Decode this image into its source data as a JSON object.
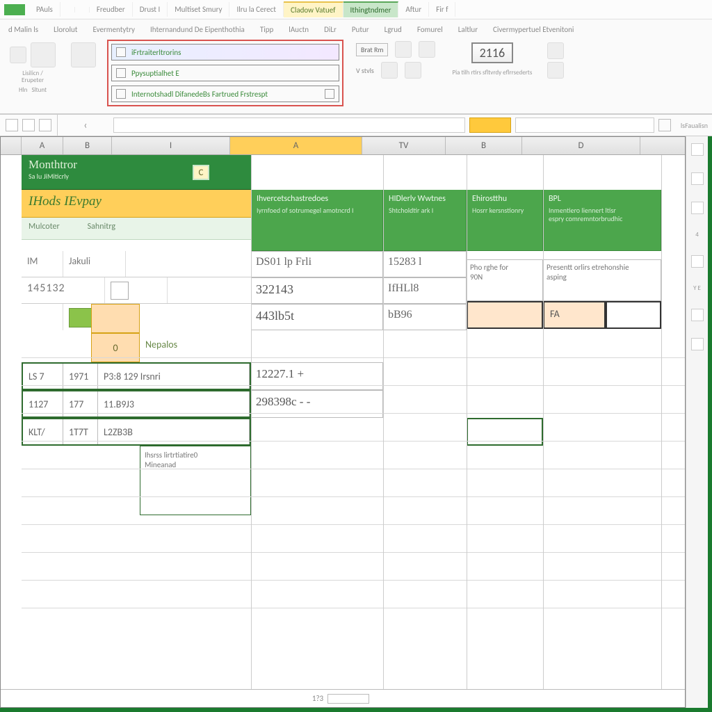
{
  "tabs": {
    "items": [
      "PAuls",
      "",
      "",
      "Freudber",
      "Drust I",
      "Multiset Smury",
      "Ilru la Cerect",
      "Cladow Vatuef",
      "Ithingtndmer",
      "Aftur",
      "Fir f"
    ],
    "active_yellow_index": 7,
    "active_green_index": 8
  },
  "ribbon_row1": [
    "d Malin ls",
    "Llorolut",
    "Evermentytry",
    "Ihternandund De Eipenthothia",
    "Tipp",
    "lAuctn",
    "DiLr",
    "Putur",
    "Lgrud",
    "Fomurel",
    "Laltlur",
    "Civermypertuel Etvenitoni"
  ],
  "ribbon": {
    "grp1_label": "Lisilicn /",
    "grp1_sub": "Hln",
    "grp2_label": "Erupeter",
    "grp2_sub": "Sltunt",
    "panel": {
      "line1": "iFrtraiterltrorins",
      "line2": "Ppysuptialhet E",
      "line3": "Internotshadl DifanedeBs Fartrued Frstrespt"
    },
    "mid": {
      "btn1": "Brat Rm",
      "line2": "V stvls"
    },
    "numbox": "2116",
    "right": {
      "line1": "Pia tilh rtirs sfltvrdy eflrrsederts"
    }
  },
  "fxbar": {
    "tail": "lsFaualisn"
  },
  "colheaders": [
    "A",
    "B",
    "I",
    "A",
    "TV",
    "B",
    "D"
  ],
  "banner": {
    "title": "Monthtror",
    "subtitle": "Sa lu JiMiticrly",
    "chip": "C"
  },
  "banner2": "IHods IEvpay",
  "headers": {
    "e1": "Ihvercetschastredoes",
    "e2": "Iyrnfoed of sotrumegel amotncrd I",
    "f1": "HIDlerlv Wwtnes",
    "f2": "Shtcholdtir ark I",
    "g1": "Ehirostthu",
    "g2": "Hosrr kersnstionry",
    "h1": "BPL",
    "h2": "Inmentiero liennert ltisr",
    "h3": "espry comremntorbrudhic"
  },
  "subhdr": {
    "c1": "Mulcoter",
    "c2": "Sahnitrg"
  },
  "leftcol": {
    "r1c1": "IM",
    "r1c2": "Jakuli",
    "r2c1": "145132"
  },
  "midvals": {
    "e1": "DS01 lp Frli",
    "f1": "15283 l",
    "e2": "322143",
    "f2": "IfHLl8",
    "e3": "443lb5t",
    "f3": "bB96",
    "e4": "12227.1  +",
    "e5": "298398c  -  -"
  },
  "notecells": {
    "g_label": "Pho rghe for",
    "g_val": "90N",
    "h_label": "Presentt orlirs etrehonshie",
    "h_val": "asping",
    "h_input": "FA"
  },
  "orangechip": "0",
  "notes_label": "Nepalos",
  "datarows": {
    "r1": {
      "c1": "LS 7",
      "c2": "1971",
      "c3": "P3:8 129 Irsnri"
    },
    "r2": {
      "c1": "1127",
      "c2": "177",
      "c3": "11.B9J3"
    },
    "r3": {
      "c1": "KLT/",
      "c2": "1T7T",
      "c3": "L2ZB3B"
    }
  },
  "leftover": {
    "l1": "Ihsrss lirtrtiatire0",
    "l2": "Mineanad"
  },
  "status": {
    "val": "1?3"
  }
}
